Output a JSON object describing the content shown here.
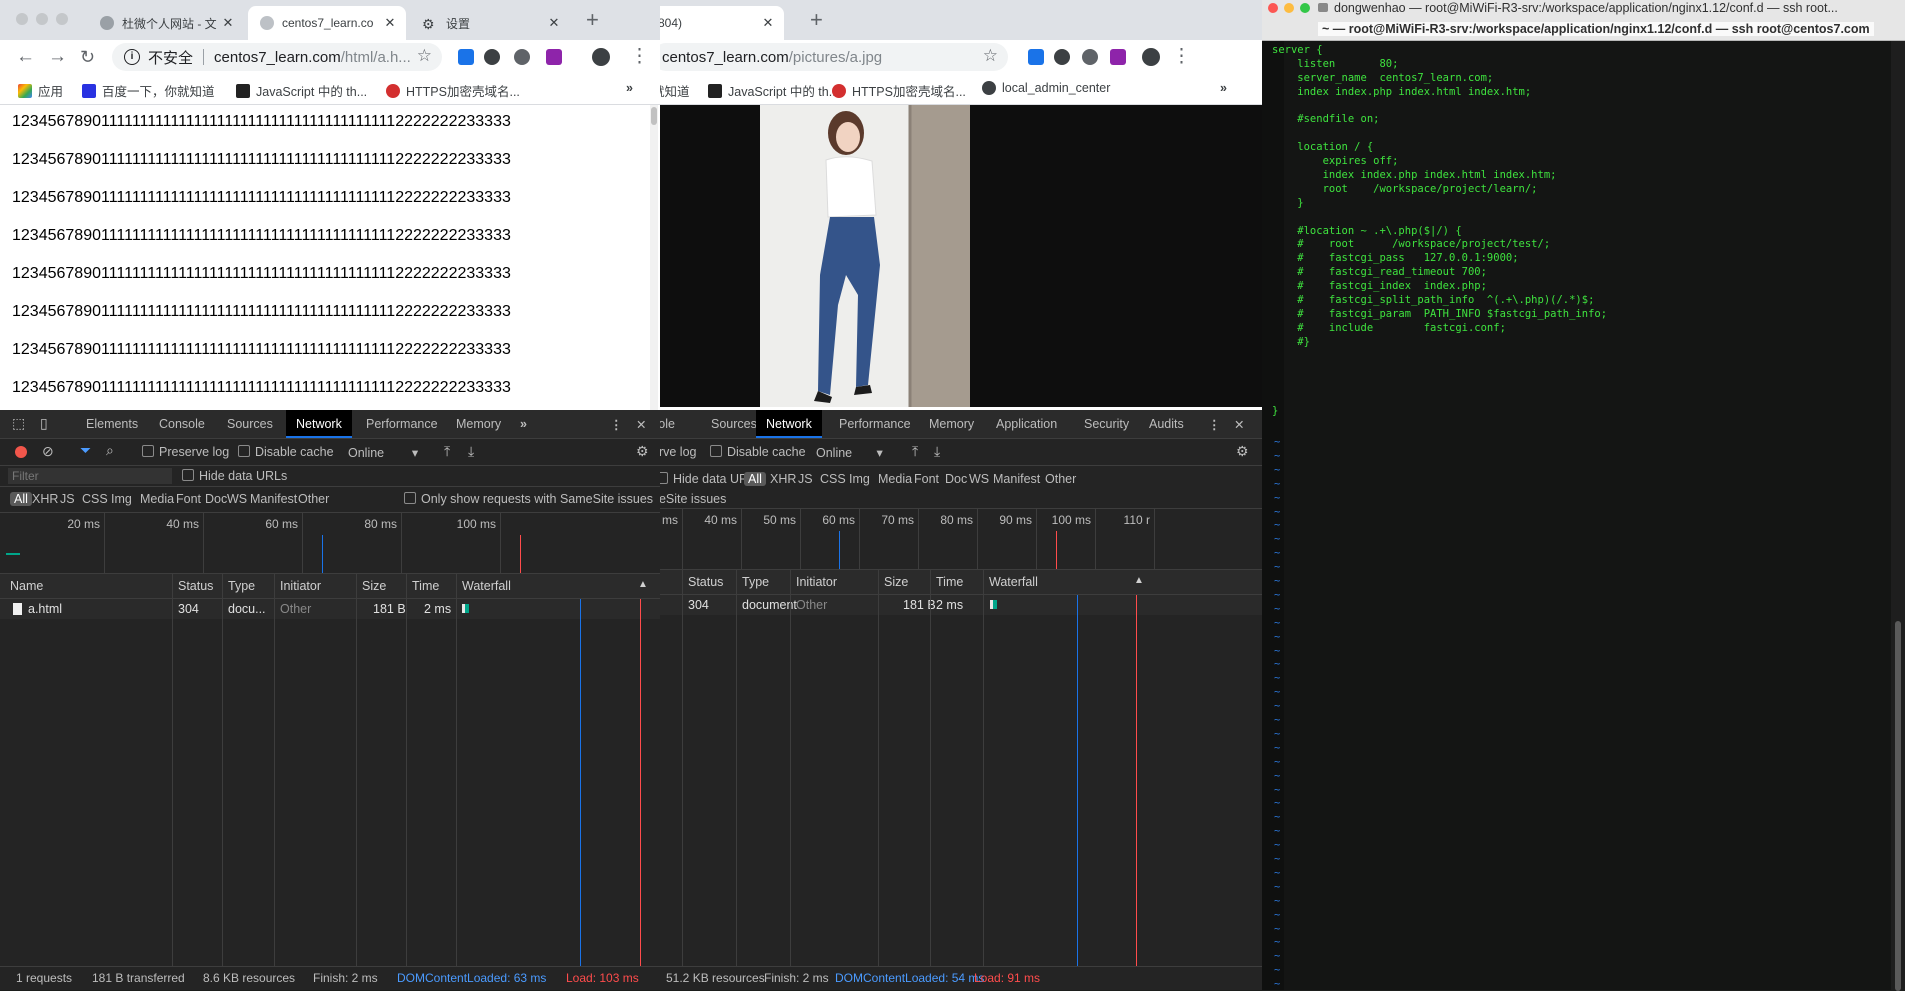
{
  "left_browser": {
    "tabs": [
      {
        "title": "杜微个人网站 - 文"
      },
      {
        "title": "centos7_learn.co"
      },
      {
        "title": "设置"
      }
    ],
    "security_label": "不安全",
    "url_host": "centos7_learn.com",
    "url_path": "/html/a.h...",
    "bookmarks": [
      "应用",
      "百度一下，你就知道",
      "JavaScript 中的 th...",
      "HTTPS加密壳域名..."
    ],
    "page_lines": [
      "1234567890111111111111111111111111111111111111112222222233333",
      "1234567890111111111111111111111111111111111111112222222233333",
      "1234567890111111111111111111111111111111111111112222222233333",
      "1234567890111111111111111111111111111111111111112222222233333",
      "1234567890111111111111111111111111111111111111112222222233333",
      "1234567890111111111111111111111111111111111111112222222233333",
      "1234567890111111111111111111111111111111111111112222222233333",
      "1234567890111111111111111111111111111111111111112222222233333"
    ],
    "devtools": {
      "tabs": [
        "Elements",
        "Console",
        "Sources",
        "Network",
        "Performance",
        "Memory"
      ],
      "more": "»",
      "preserve_log": "Preserve log",
      "disable_cache": "Disable cache",
      "throttle": "Online",
      "hide_data_urls": "Hide data URLs",
      "filter_placeholder": "Filter",
      "filter_types": [
        "All",
        "XHR",
        "JS",
        "CSS",
        "Img",
        "Media",
        "Font",
        "Doc",
        "WS",
        "Manifest",
        "Other"
      ],
      "samesite": "Only show requests with SameSite issues",
      "overview_ticks": [
        "20 ms",
        "40 ms",
        "60 ms",
        "80 ms",
        "100 ms"
      ],
      "columns": [
        "Name",
        "Status",
        "Type",
        "Initiator",
        "Size",
        "Time",
        "Waterfall"
      ],
      "row": {
        "name": "a.html",
        "status": "304",
        "type": "docu...",
        "initiator": "Other",
        "size": "181 B",
        "time": "2 ms"
      },
      "status_bar": {
        "requests": "1 requests",
        "transferred": "181 B transferred",
        "resources": "8.6 KB resources",
        "finish": "Finish: 2 ms",
        "dcl": "DOMContentLoaded: 63 ms",
        "load": "Load: 103 ms"
      }
    }
  },
  "right_browser": {
    "tab_title": "804)",
    "url_host": "centos7_learn.com",
    "url_path": "/pictures/a.jpg",
    "bookmarks": [
      "就知道",
      "JavaScript 中的 th...",
      "HTTPS加密壳域名...",
      "local_admin_center"
    ],
    "devtools": {
      "tabs": [
        "sole",
        "Sources",
        "Network",
        "Performance",
        "Memory",
        "Application",
        "Security",
        "Audits"
      ],
      "preserve_log": "erve log",
      "disable_cache": "Disable cache",
      "throttle": "Online",
      "hide_data_urls": "Hide data URLs",
      "filter_types": [
        "All",
        "XHR",
        "JS",
        "CSS",
        "Img",
        "Media",
        "Font",
        "Doc",
        "WS",
        "Manifest",
        "Other"
      ],
      "samesite": "neSite issues",
      "overview_ticks": [
        "30 ms",
        "40 ms",
        "50 ms",
        "60 ms",
        "70 ms",
        "80 ms",
        "90 ms",
        "100 ms",
        "110 r"
      ],
      "columns": [
        "Status",
        "Type",
        "Initiator",
        "Size",
        "Time",
        "Waterfall"
      ],
      "row": {
        "status": "304",
        "type": "document",
        "initiator": "Other",
        "size": "181 B",
        "time": "2 ms"
      },
      "status_bar": {
        "resources": "51.2 KB resources",
        "finish": "Finish: 2 ms",
        "dcl": "DOMContentLoaded: 54 ms",
        "load": "Load: 91 ms"
      }
    }
  },
  "terminal": {
    "title_top": "dongwenhao — root@MiWiFi-R3-srv:/workspace/application/nginx1.12/conf.d — ssh root...",
    "title_bottom": "~ — root@MiWiFi-R3-srv:/workspace/application/nginx1.12/conf.d — ssh root@centos7.com",
    "code_lines": [
      "server {",
      "    listen       80;",
      "    server_name  centos7_learn.com;",
      "    index index.php index.html index.htm;",
      "",
      "    #sendfile on;",
      "",
      "    location / {",
      "        expires off;",
      "        index index.php index.html index.htm;",
      "        root    /workspace/project/learn/;",
      "    }",
      "",
      "    #location ~ .+\\.php($|/) {",
      "    #    root      /workspace/project/test/;",
      "    #    fastcgi_pass   127.0.0.1:9000;",
      "    #    fastcgi_read_timeout 700;",
      "    #    fastcgi_index  index.php;",
      "    #    fastcgi_split_path_info  ^(.+\\.php)(/.*)$;",
      "    #    fastcgi_param  PATH_INFO $fastcgi_path_info;",
      "    #    include        fastcgi.conf;",
      "    #}",
      "",
      "",
      "",
      "",
      "}"
    ],
    "tilde": "~"
  },
  "colors": {
    "accent_blue": "#1a73e8",
    "terminal_green": "#3fe33f",
    "dcl_blue": "#4b9bff",
    "load_red": "#ff4c4c"
  }
}
